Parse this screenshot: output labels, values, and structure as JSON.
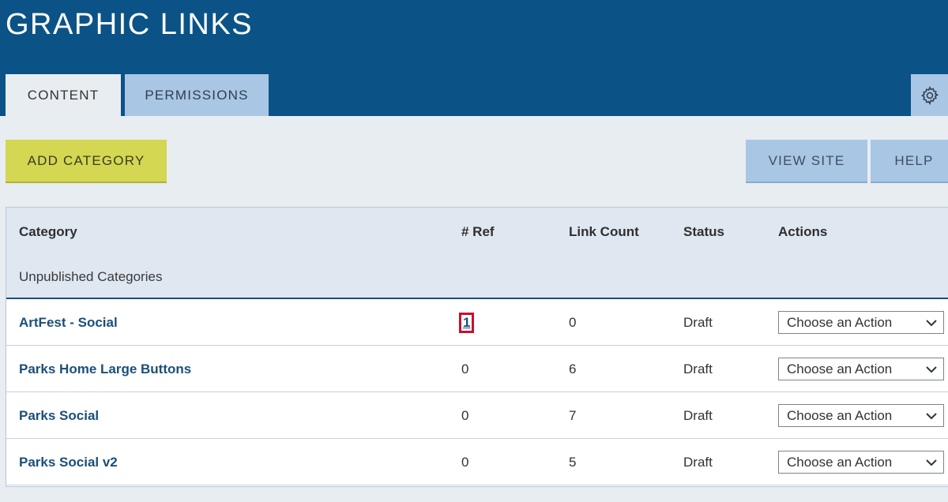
{
  "header": {
    "title": "GRAPHIC LINKS",
    "tabs": [
      {
        "label": "CONTENT"
      },
      {
        "label": "PERMISSIONS"
      }
    ],
    "settings_icon": "gear-icon"
  },
  "toolbar": {
    "add_label": "ADD CATEGORY",
    "view_site_label": "VIEW SITE",
    "help_label": "HELP"
  },
  "table": {
    "columns": [
      "Category",
      "# Ref",
      "Link Count",
      "Status",
      "Actions"
    ],
    "section_label": "Unpublished Categories",
    "rows": [
      {
        "name": "ArtFest - Social",
        "ref": "1",
        "count": "0",
        "status": "Draft",
        "action": "Choose an Action"
      },
      {
        "name": "Parks Home Large Buttons",
        "ref": "0",
        "count": "6",
        "status": "Draft",
        "action": "Choose an Action"
      },
      {
        "name": "Parks Social",
        "ref": "0",
        "count": "7",
        "status": "Draft",
        "action": "Choose an Action"
      },
      {
        "name": "Parks Social v2",
        "ref": "0",
        "count": "5",
        "status": "Draft",
        "action": "Choose an Action"
      }
    ]
  },
  "colors": {
    "header_bg": "#0b5386",
    "accent_yellow": "#d4d752",
    "light_blue": "#a9c6e4",
    "link_blue": "#1b4f7a",
    "highlight_red": "#c8102e"
  }
}
